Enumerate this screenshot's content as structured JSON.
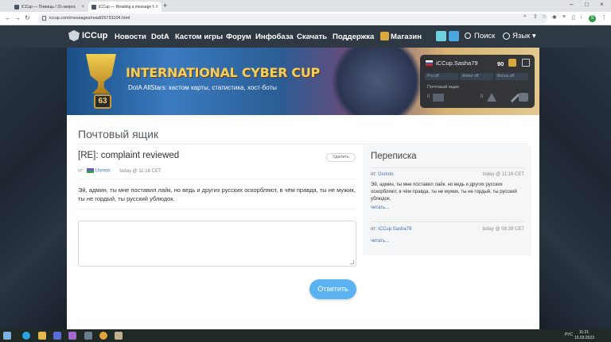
{
  "browser": {
    "tabs": [
      {
        "title": "iCCup — Помощь / 31-запрос",
        "active": false
      },
      {
        "title": "iCCup — Reading a message f...",
        "active": true
      }
    ],
    "new_tab": "+",
    "window_controls": {
      "min": "–",
      "max": "□",
      "close": "×"
    },
    "url": "iccup.com/messages/read/26731104.html",
    "nav": {
      "back": "←",
      "forward": "→",
      "reload": "↻",
      "home": "⌂"
    },
    "profile_initial": "S"
  },
  "site_nav": {
    "logo": "ICCup",
    "links": [
      "Новости",
      "DotA",
      "Кастом игры",
      "Форум",
      "Инфобаза",
      "Скачать",
      "Поддержка",
      "Магазин"
    ],
    "search": "Поиск",
    "language": "Язык ▾"
  },
  "banner": {
    "title": "INTERNATIONAL CYBER CUP",
    "subtitle": "DotA AllStars: кастом карты, статистика, хост-боты",
    "level": "63"
  },
  "user_box": {
    "username": "iCCup.Sasha79",
    "coins": "90",
    "stats": [
      "Pro off",
      "Armor off",
      "Bonus off"
    ],
    "mailbox_label": "Почтовый ящик",
    "mail_count": "0",
    "warn_count": "0"
  },
  "page": {
    "title": "Почтовый ящик"
  },
  "message": {
    "subject": "[RE]: complaint reviewed",
    "delete_label": "Удалить",
    "from_prefix": "от:",
    "author": "Usmon.",
    "date": "today @ 11:16 CET",
    "body": "Эй, админ, ты мне поставил лайк, но ведь и других русских оскорбляют, в чём правда, ты не мужик, ты не гордый, ты русский ублюдок.",
    "reply_label": "Ответить"
  },
  "correspondence": {
    "title": "Переписка",
    "items": [
      {
        "from_prefix": "от:",
        "who": "Usmon.",
        "when": "today @ 11:16 CET",
        "snippet": "Эй, админ, ты мне поставил лайк, но ведь и других русских оскорбляют, в чём правда, ты не мужик, ты не гордый, ты русский ублюдок.",
        "read": "читать..."
      },
      {
        "from_prefix": "от:",
        "who": "iCCup.Sasha79",
        "when": "today @ 08:39 CET",
        "snippet": "",
        "read": "читать..."
      }
    ]
  },
  "taskbar": {
    "lang": "РУС",
    "time": "11:21",
    "date": "15.03.2023"
  },
  "colors": {
    "nav_bg": "#2f3944",
    "accent_button": "#5ab3f0",
    "link": "#3a6fb0",
    "banner_title": "#f3d05b"
  }
}
